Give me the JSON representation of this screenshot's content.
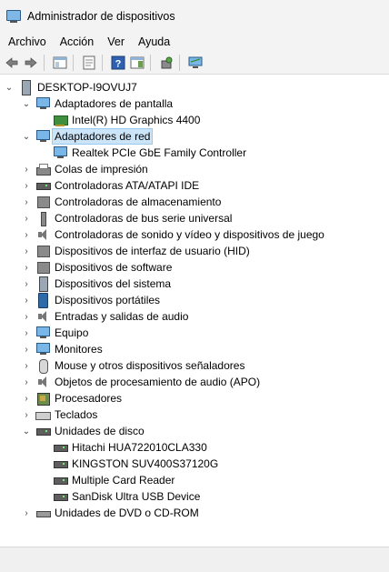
{
  "window": {
    "title": "Administrador de dispositivos",
    "icon": "device-manager-icon"
  },
  "menu": [
    "Archivo",
    "Acción",
    "Ver",
    "Ayuda"
  ],
  "toolbar": [
    "back-arrow-icon",
    "forward-arrow-icon",
    "show-hide-console-tree-icon",
    "properties-icon",
    "help-icon",
    "action-pane-icon",
    "scan-hardware-icon",
    "monitor-icon"
  ],
  "tree": {
    "root": {
      "label": "DESKTOP-I9OVUJ7",
      "expanded": true,
      "icon": "computer-icon"
    },
    "items": [
      {
        "label": "Adaptadores de pantalla",
        "expanded": true,
        "icon": "display-adapter-icon",
        "children": [
          {
            "label": "Intel(R) HD Graphics 4400",
            "icon": "display-card-icon"
          }
        ]
      },
      {
        "label": "Adaptadores de red",
        "expanded": true,
        "selected": true,
        "icon": "network-adapter-icon",
        "children": [
          {
            "label": "Realtek PCIe GbE Family Controller",
            "icon": "network-card-icon"
          }
        ]
      },
      {
        "label": "Colas de impresión",
        "icon": "printer-icon"
      },
      {
        "label": "Controladoras ATA/ATAPI IDE",
        "icon": "ide-controller-icon"
      },
      {
        "label": "Controladoras de almacenamiento",
        "icon": "storage-controller-icon"
      },
      {
        "label": "Controladoras de bus serie universal",
        "icon": "usb-icon"
      },
      {
        "label": "Controladoras de sonido y vídeo y dispositivos de juego",
        "icon": "speaker-icon"
      },
      {
        "label": "Dispositivos de interfaz de usuario (HID)",
        "icon": "hid-icon"
      },
      {
        "label": "Dispositivos de software",
        "icon": "software-device-icon"
      },
      {
        "label": "Dispositivos del sistema",
        "icon": "system-device-icon"
      },
      {
        "label": "Dispositivos portátiles",
        "icon": "portable-device-icon"
      },
      {
        "label": "Entradas y salidas de audio",
        "icon": "audio-icon"
      },
      {
        "label": "Equipo",
        "icon": "computer-monitor-icon"
      },
      {
        "label": "Monitores",
        "icon": "monitor-icon"
      },
      {
        "label": "Mouse y otros dispositivos señaladores",
        "icon": "mouse-icon"
      },
      {
        "label": "Objetos de procesamiento de audio (APO)",
        "icon": "audio-processing-icon"
      },
      {
        "label": "Procesadores",
        "icon": "processor-icon"
      },
      {
        "label": "Teclados",
        "icon": "keyboard-icon"
      },
      {
        "label": "Unidades de disco",
        "expanded": true,
        "icon": "disk-drive-icon",
        "children": [
          {
            "label": "Hitachi HUA722010CLA330",
            "icon": "hard-disk-icon"
          },
          {
            "label": "KINGSTON SUV400S37120G",
            "icon": "hard-disk-icon"
          },
          {
            "label": "Multiple Card Reader",
            "icon": "hard-disk-icon"
          },
          {
            "label": "SanDisk Ultra USB Device",
            "icon": "hard-disk-icon"
          }
        ]
      },
      {
        "label": "Unidades de DVD o CD-ROM",
        "icon": "dvd-drive-icon"
      }
    ]
  }
}
